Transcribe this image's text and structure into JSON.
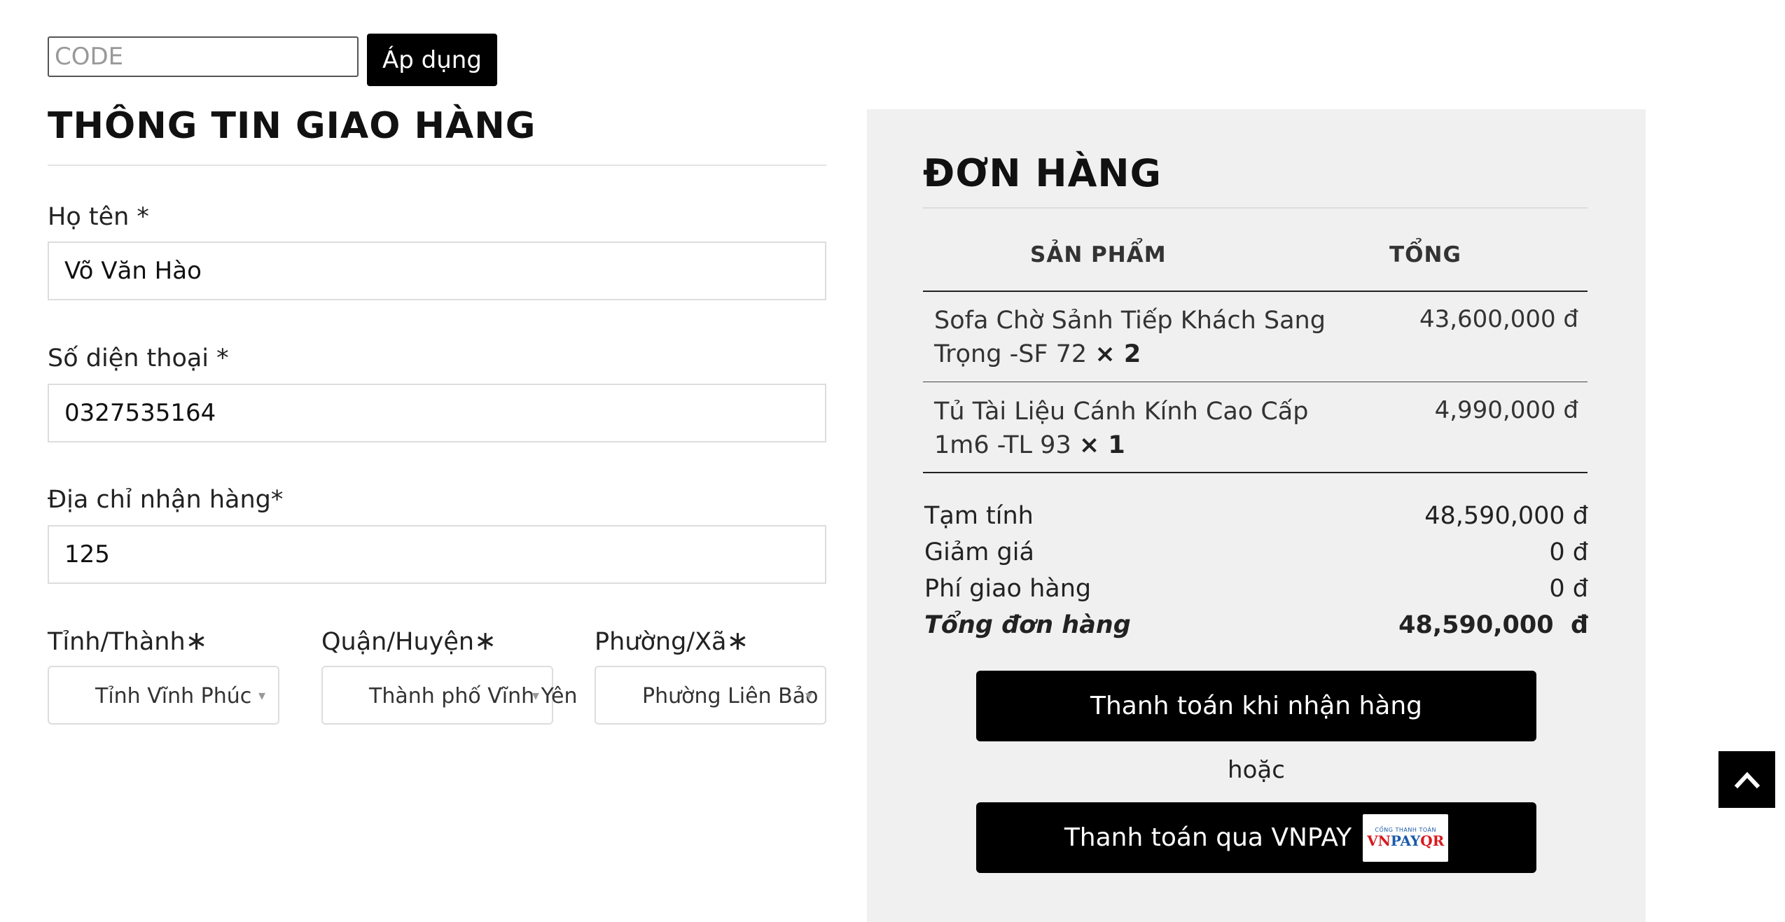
{
  "coupon": {
    "placeholder": "CODE",
    "apply_label": "Áp dụng"
  },
  "shipping": {
    "title": "THÔNG TIN GIAO HÀNG",
    "name_label": "Họ tên *",
    "name_value": "Võ Văn Hào",
    "phone_label": "Số diện thoại *",
    "phone_value": "0327535164",
    "address_label": "Địa chỉ nhận hàng*",
    "address_value": "125",
    "province_label": "Tỉnh/Thành",
    "province_value": "Tỉnh Vĩnh Phúc",
    "district_label": "Quận/Huyện",
    "district_value": "Thành phố Vĩnh Yên",
    "ward_label": "Phường/Xã",
    "ward_value": "Phường Liên Bảo",
    "required_mark": "∗",
    "caret": "▾"
  },
  "order": {
    "title": "ĐƠN HÀNG",
    "col_product": "SẢN PHẨM",
    "col_total": "TỔNG",
    "items": [
      {
        "name": "Sofa Chờ Sảnh Tiếp Khách Sang Trọng -SF 72",
        "qty": "× 2",
        "price": "43,600,000 đ"
      },
      {
        "name": "Tủ Tài Liệu Cánh Kính Cao Cấp 1m6 -TL 93",
        "qty": "× 1",
        "price": "4,990,000 đ"
      }
    ],
    "subtotal_label": "Tạm tính",
    "subtotal_value": "48,590,000 đ",
    "discount_label": "Giảm giá",
    "discount_value": "0 đ",
    "shipping_label": "Phí giao hàng",
    "shipping_value": "0 đ",
    "total_label": "Tổng đơn hàng",
    "total_value": "48,590,000  đ",
    "cod_label": "Thanh toán khi nhận hàng",
    "or_label": "hoặc",
    "vnpay_label": "Thanh toán qua VNPAY",
    "vnpay_logo_small": "CỔNG THANH TOÁN",
    "vnpay_logo_vn": "VN",
    "vnpay_logo_pay": "PAY",
    "vnpay_logo_qr": "QR"
  },
  "icons": {
    "back_to_top": "chevron-up-icon"
  }
}
